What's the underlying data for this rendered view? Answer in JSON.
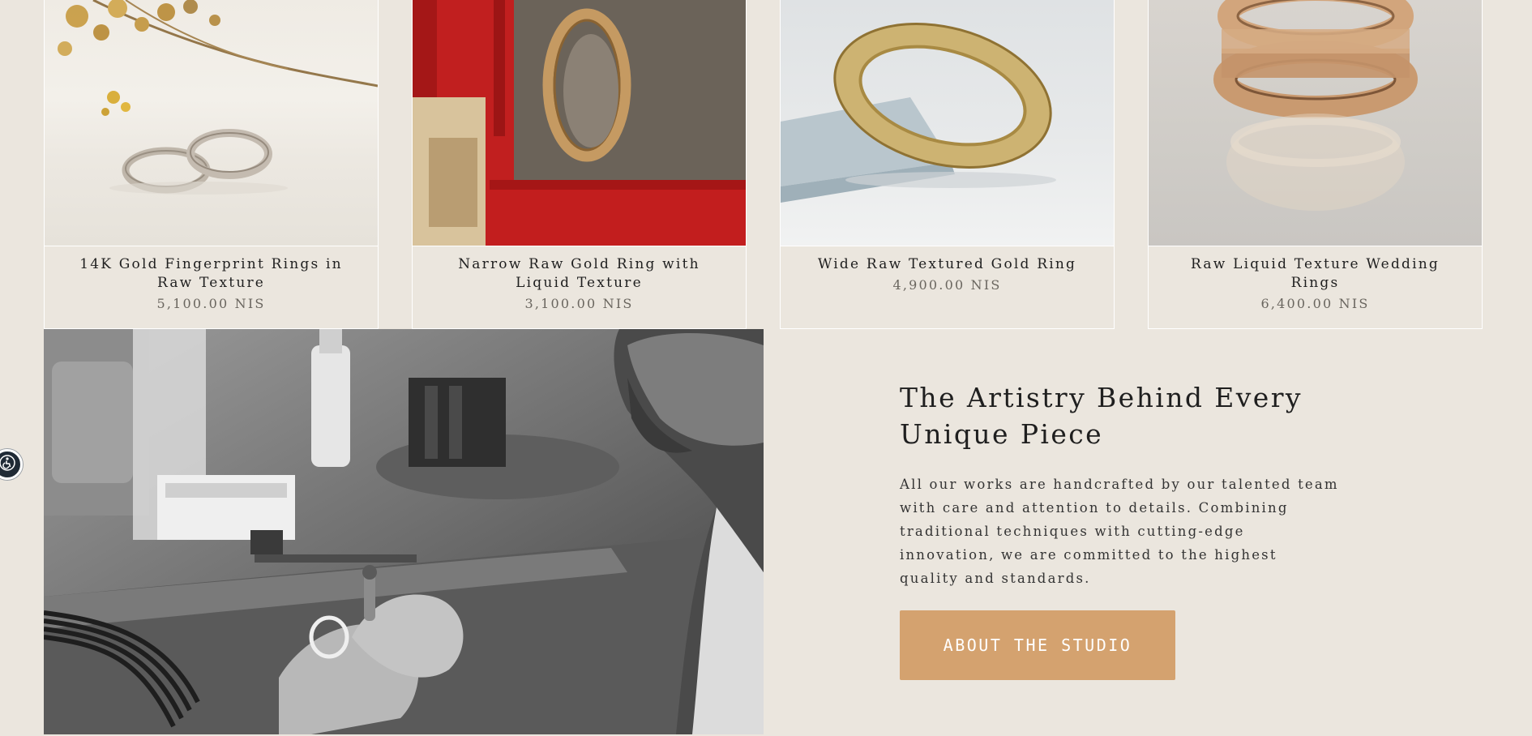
{
  "products": [
    {
      "title": "14K Gold Fingerprint Rings in Raw Texture",
      "price": "5,100.00 NIS",
      "image_icon": "fingerprint-rings-photo"
    },
    {
      "title": "Narrow Raw Gold Ring with Liquid Texture",
      "price": "3,100.00 NIS",
      "image_icon": "narrow-raw-ring-photo"
    },
    {
      "title": "Wide Raw Textured Gold Ring",
      "price": "4,900.00 NIS",
      "image_icon": "wide-textured-ring-photo"
    },
    {
      "title": "Raw Liquid Texture Wedding Rings",
      "price": "6,400.00 NIS",
      "image_icon": "liquid-wedding-rings-photo"
    }
  ],
  "about": {
    "heading": "The Artistry Behind Every Unique Piece",
    "body": "All our works are handcrafted by our talented team with care and attention to details. Combining traditional techniques with cutting-edge innovation, we are committed to the highest quality and standards.",
    "button_label": "ABOUT THE STUDIO"
  },
  "accessibility": {
    "icon": "accessibility-icon"
  },
  "colors": {
    "page_background": "#ebe6de",
    "button_accent": "#d4a26f",
    "text": "#1f1f1f",
    "price_text": "#6a665f"
  }
}
